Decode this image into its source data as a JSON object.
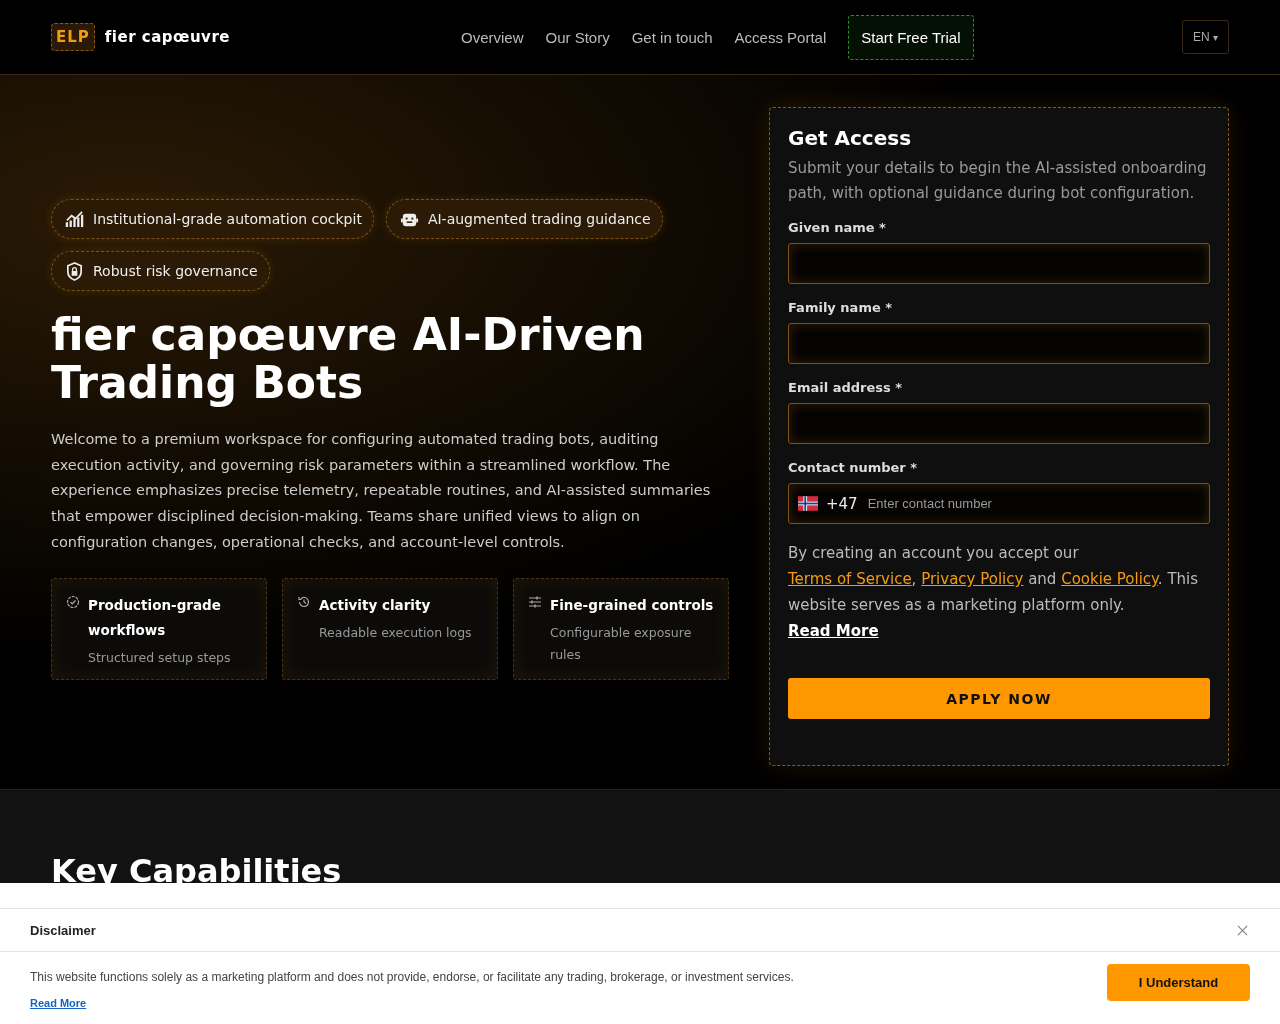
{
  "header": {
    "logo_badge": "ELP",
    "brand": "fier capœuvre",
    "nav": [
      {
        "label": "Overview",
        "kind": "link"
      },
      {
        "label": "Our Story",
        "kind": "link"
      },
      {
        "label": "Get in touch",
        "kind": "link"
      },
      {
        "label": "Access Portal",
        "kind": "link"
      },
      {
        "label": "Start Free Trial",
        "kind": "cta"
      }
    ],
    "language": {
      "code": "EN",
      "caret": "▾"
    }
  },
  "hero": {
    "badges": [
      {
        "kind": "chart",
        "label": "Institutional-grade automation cockpit"
      },
      {
        "kind": "robot",
        "label": "AI-augmented trading guidance"
      },
      {
        "kind": "shield",
        "label": "Robust risk governance"
      }
    ],
    "title": "fier capœuvre AI-Driven Trading Bots",
    "description": "Welcome to a premium workspace for configuring automated trading bots, auditing execution activity, and governing risk parameters within a streamlined workflow. The experience emphasizes precise telemetry, repeatable routines, and AI-assisted summaries that empower disciplined decision-making. Teams share unified views to align on configuration changes, operational checks, and account-level controls.",
    "features": [
      {
        "kind": "badge",
        "title": "Production-grade workflows",
        "subtitle": "Structured setup steps"
      },
      {
        "kind": "history",
        "title": "Activity clarity",
        "subtitle": "Readable execution logs"
      },
      {
        "kind": "sliders",
        "title": "Fine-grained controls",
        "subtitle": "Configurable exposure rules"
      }
    ]
  },
  "form": {
    "title": "Get Access",
    "intro": "Submit your details to begin the AI-assisted onboarding path, with optional guidance during bot configuration.",
    "fields": [
      {
        "label": "Given name *",
        "kind": "text"
      },
      {
        "label": "Family name *",
        "kind": "text"
      },
      {
        "label": "Email address *",
        "kind": "text"
      },
      {
        "label": "Contact number *",
        "kind": "phone",
        "dial_code": "+47",
        "placeholder": "Enter contact number"
      }
    ],
    "consent": [
      {
        "text": "By creating an account you accept our ",
        "kind": "plain"
      },
      {
        "text": "Terms of Service",
        "kind": "link"
      },
      {
        "text": ", ",
        "kind": "plain"
      },
      {
        "text": "Privacy Policy",
        "kind": "link"
      },
      {
        "text": " and ",
        "kind": "plain"
      },
      {
        "text": "Cookie Policy",
        "kind": "link"
      },
      {
        "text": ". This website serves as a marketing platform only. ",
        "kind": "plain"
      },
      {
        "text": "Read More",
        "kind": "strong_link"
      }
    ],
    "submit": "APPLY NOW"
  },
  "next_section": {
    "title": "Key Capabilities"
  },
  "disclaimer": {
    "title": "Disclaimer",
    "text": "This website functions solely as a marketing platform and does not provide, endorse, or facilitate any trading, brokerage, or investment services.",
    "read_more": "Read More",
    "button": "I Understand"
  }
}
